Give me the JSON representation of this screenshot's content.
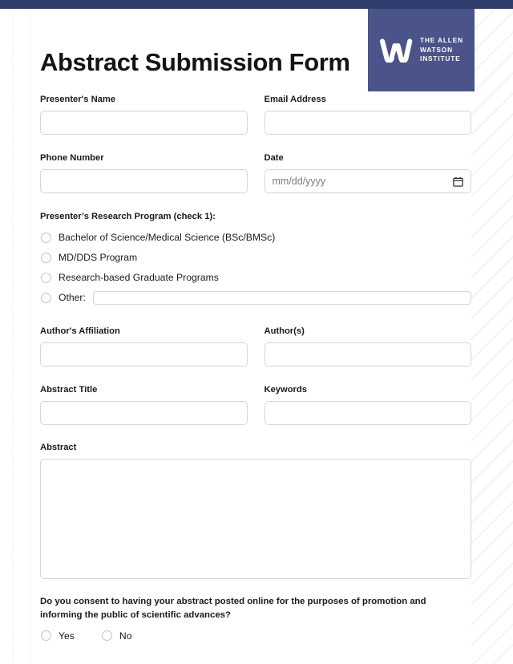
{
  "brand": {
    "logo_line1": "THE ALLEN",
    "logo_line2": "WATSON",
    "logo_line3": "INSTITUTE",
    "logo_mark_name": "allen-watson-w-a-monogram",
    "topbar_color": "#2e3d6b",
    "logo_block_color": "#4a5488",
    "logo_text_color": "#ffffff"
  },
  "header": {
    "title": "Abstract Submission Form"
  },
  "fields": {
    "presenter_name": {
      "label": "Presenter's Name",
      "value": "",
      "placeholder": ""
    },
    "email": {
      "label": "Email Address",
      "value": "",
      "placeholder": ""
    },
    "phone": {
      "label": "Phone Number",
      "value": "",
      "placeholder": ""
    },
    "date": {
      "label": "Date",
      "value": "",
      "placeholder": "mm/dd/yyyy",
      "icon": "calendar-icon"
    },
    "affiliation": {
      "label": "Author's Affiliation",
      "value": "",
      "placeholder": ""
    },
    "authors": {
      "label": "Author(s)",
      "value": "",
      "placeholder": ""
    },
    "abstract_title": {
      "label": "Abstract Title",
      "value": "",
      "placeholder": ""
    },
    "keywords": {
      "label": "Keywords",
      "value": "",
      "placeholder": ""
    },
    "abstract": {
      "label": "Abstract",
      "value": "",
      "placeholder": ""
    }
  },
  "research_program": {
    "label": "Presenter’s Research Program (check 1):",
    "options": [
      {
        "label": "Bachelor of Science/Medical Science (BSc/BMSc)",
        "selected": false
      },
      {
        "label": "MD/DDS Program",
        "selected": false
      },
      {
        "label": "Research-based Graduate Programs",
        "selected": false
      },
      {
        "label": "Other:",
        "selected": false,
        "has_input": true,
        "value": ""
      }
    ]
  },
  "consent": {
    "question": "Do you consent to having your abstract posted online for the purposes of promotion and informing the public of scientific advances?",
    "options": [
      {
        "label": "Yes",
        "selected": false
      },
      {
        "label": "No",
        "selected": false
      }
    ]
  }
}
